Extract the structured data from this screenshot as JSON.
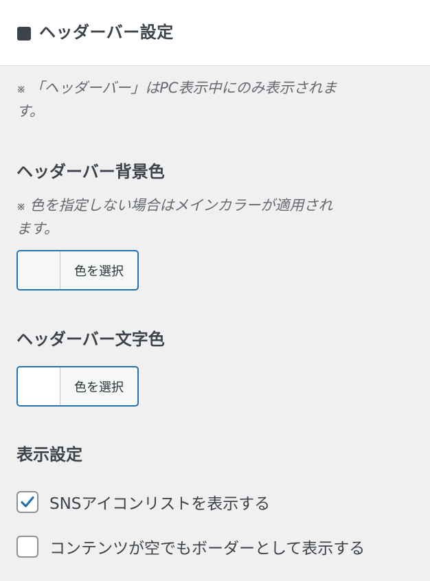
{
  "header": {
    "title": "ヘッダーバー設定"
  },
  "intro_note": {
    "mark": "※",
    "text_line1": "「ヘッダーバー」はPC表示中にのみ表示されま",
    "text_line2": "す。"
  },
  "background_color": {
    "title": "ヘッダーバー背景色",
    "note_mark": "※",
    "note_line1": "色を指定しない場合はメインカラーが適用され",
    "note_line2": "ます。",
    "button_label": "色を選択",
    "swatch_color": "#f6f7f7"
  },
  "text_color": {
    "title": "ヘッダーバー文字色",
    "button_label": "色を選択",
    "swatch_color": "#ffffff"
  },
  "display_settings": {
    "title": "表示設定",
    "options": [
      {
        "label": "SNSアイコンリストを表示する",
        "checked": true
      },
      {
        "label": "コンテンツが空でもボーダーとして表示する",
        "checked": false
      }
    ]
  },
  "colors": {
    "accent": "#2271b1",
    "header_bg": "#ffffff",
    "panel_bg": "#f0f0f1"
  }
}
